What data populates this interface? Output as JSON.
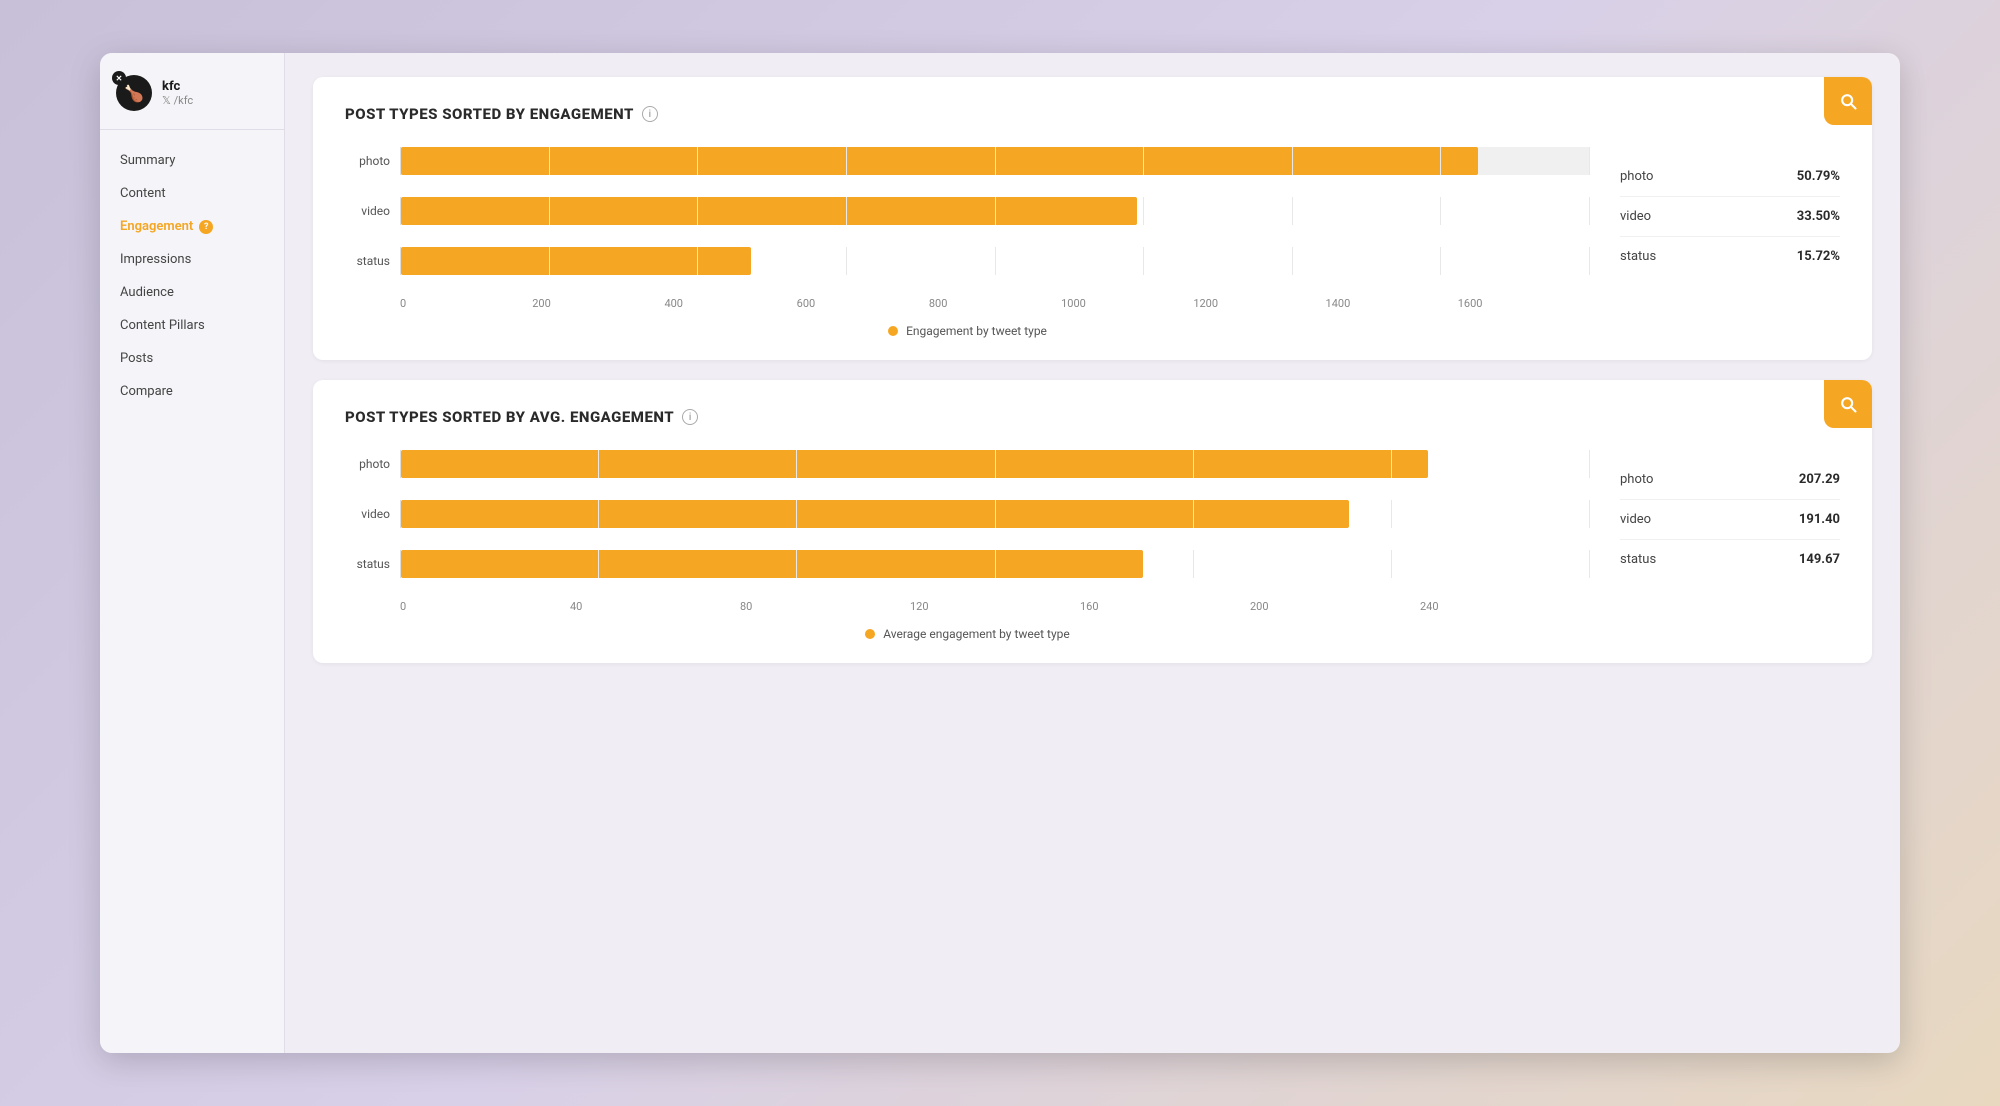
{
  "profile": {
    "name": "kfc",
    "handle": "𝕏 /kfc",
    "icon": "🍗"
  },
  "sidebar": {
    "items": [
      {
        "id": "summary",
        "label": "Summary",
        "active": false
      },
      {
        "id": "content",
        "label": "Content",
        "active": false
      },
      {
        "id": "engagement",
        "label": "Engagement",
        "active": true,
        "help": true
      },
      {
        "id": "impressions",
        "label": "Impressions",
        "active": false
      },
      {
        "id": "audience",
        "label": "Audience",
        "active": false
      },
      {
        "id": "content-pillars",
        "label": "Content Pillars",
        "active": false
      },
      {
        "id": "posts",
        "label": "Posts",
        "active": false
      },
      {
        "id": "compare",
        "label": "Compare",
        "active": false
      }
    ]
  },
  "chart1": {
    "title": "POST TYPES SORTED BY ENGAGEMENT",
    "legend_label": "Engagement by tweet type",
    "bars": [
      {
        "label": "photo",
        "value": 1450,
        "max": 1600,
        "pct": 90.6
      },
      {
        "label": "video",
        "value": 990,
        "max": 1600,
        "pct": 61.9
      },
      {
        "label": "status",
        "value": 470,
        "max": 1600,
        "pct": 29.4
      }
    ],
    "x_labels": [
      "0",
      "200",
      "400",
      "600",
      "800",
      "1000",
      "1200",
      "1400",
      "1600"
    ],
    "table": [
      {
        "type": "photo",
        "value": "50.79%"
      },
      {
        "type": "video",
        "value": "33.50%"
      },
      {
        "type": "status",
        "value": "15.72%"
      }
    ]
  },
  "chart2": {
    "title": "POST TYPES SORTED BY AVG. ENGAGEMENT",
    "legend_label": "Average engagement by tweet type",
    "bars": [
      {
        "label": "photo",
        "value": 207.29,
        "max": 240,
        "pct": 86.4
      },
      {
        "label": "video",
        "value": 191.4,
        "max": 240,
        "pct": 79.75
      },
      {
        "label": "status",
        "value": 149.67,
        "max": 240,
        "pct": 62.4
      }
    ],
    "x_labels": [
      "0",
      "40",
      "80",
      "120",
      "160",
      "200",
      "240"
    ],
    "table": [
      {
        "type": "photo",
        "value": "207.29"
      },
      {
        "type": "video",
        "value": "191.40"
      },
      {
        "type": "status",
        "value": "149.67"
      }
    ]
  }
}
